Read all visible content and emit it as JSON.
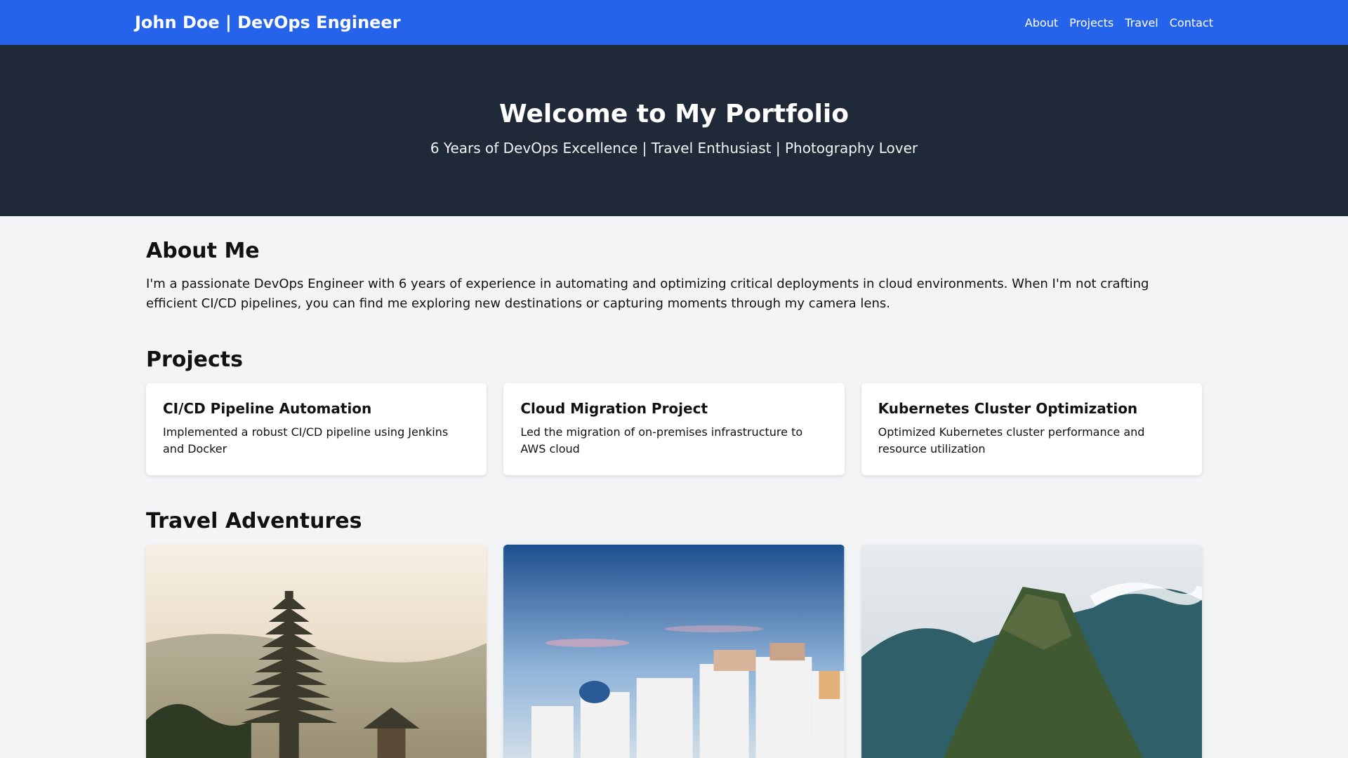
{
  "nav": {
    "brand": "John Doe | DevOps Engineer",
    "links": [
      "About",
      "Projects",
      "Travel",
      "Contact"
    ]
  },
  "hero": {
    "title": "Welcome to My Portfolio",
    "subtitle": "6 Years of DevOps Excellence | Travel Enthusiast | Photography Lover"
  },
  "about": {
    "heading": "About Me",
    "text": "I'm a passionate DevOps Engineer with 6 years of experience in automating and optimizing critical deployments in cloud environments. When I'm not crafting efficient CI/CD pipelines, you can find me exploring new destinations or capturing moments through my camera lens."
  },
  "projects": {
    "heading": "Projects",
    "items": [
      {
        "title": "CI/CD Pipeline Automation",
        "desc": "Implemented a robust CI/CD pipeline using Jenkins and Docker"
      },
      {
        "title": "Cloud Migration Project",
        "desc": "Led the migration of on-premises infrastructure to AWS cloud"
      },
      {
        "title": "Kubernetes Cluster Optimization",
        "desc": "Optimized Kubernetes cluster performance and resource utilization"
      }
    ]
  },
  "travel": {
    "heading": "Travel Adventures"
  },
  "colors": {
    "nav": "#2563eb",
    "hero": "#1f2937",
    "page": "#f3f4f6"
  }
}
